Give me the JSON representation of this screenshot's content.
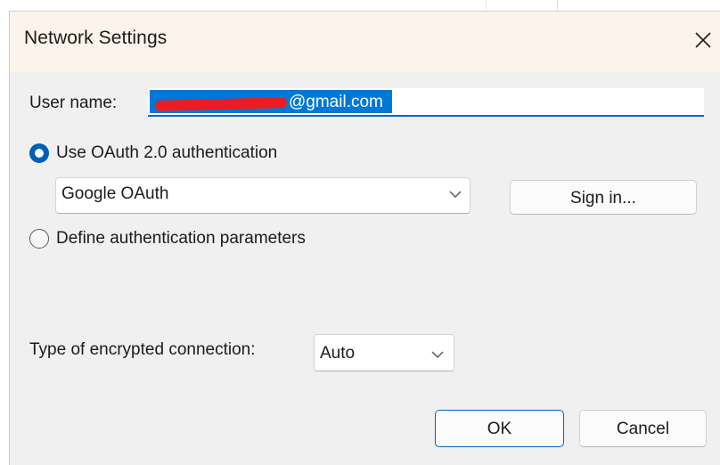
{
  "dialog": {
    "title": "Network Settings"
  },
  "username": {
    "label": "User name:",
    "value_visible": "@gmail.com"
  },
  "auth": {
    "oauth_label": "Use OAuth 2.0 authentication",
    "oauth_checked": true,
    "provider_selected": "Google OAuth",
    "sign_in_label": "Sign in...",
    "define_label": "Define authentication parameters",
    "define_checked": false
  },
  "encryption": {
    "label": "Type of encrypted connection:",
    "selected": "Auto"
  },
  "buttons": {
    "ok_label": "OK",
    "cancel_label": "Cancel"
  },
  "colors": {
    "accent": "#0067c0",
    "selection": "#0078d7",
    "titlebar": "#fcf3ea",
    "body": "#f0f0f0",
    "redaction": "#ec1c24"
  },
  "icons": {
    "close": "close-icon",
    "dropdown": "chevron-down-icon"
  }
}
